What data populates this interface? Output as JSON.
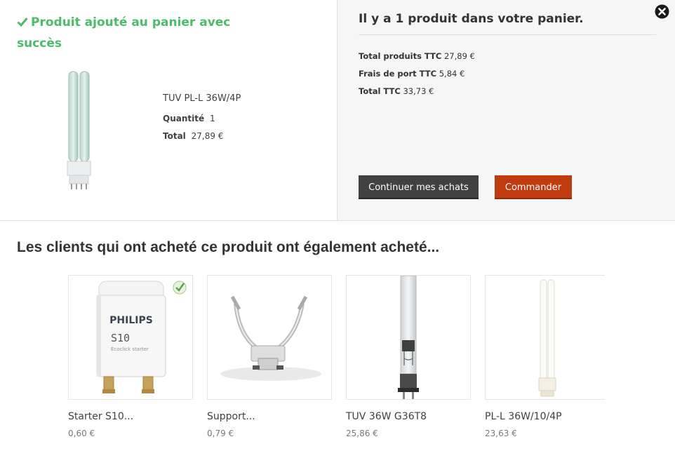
{
  "modal": {
    "success_message": "Produit ajouté au panier avec succès",
    "product": {
      "name": "TUV PL-L 36W/4P",
      "quantity_label": "Quantité",
      "quantity": "1",
      "total_label": "Total",
      "total": "27,89 €"
    },
    "cart": {
      "count_text": "Il y a 1 produit dans votre panier.",
      "totals": [
        {
          "label": "Total produits TTC",
          "value": "27,89 €"
        },
        {
          "label": "Frais de port TTC",
          "value": "5,84 €"
        },
        {
          "label": "Total TTC",
          "value": "33,73 €"
        }
      ]
    },
    "buttons": {
      "continue": "Continuer mes achats",
      "order": "Commander"
    }
  },
  "crossselling": {
    "title": "Les clients qui ont acheté ce produit ont également acheté...",
    "products": [
      {
        "name": "Starter S10...",
        "price": "0,60 €",
        "brand": "PHILIPS",
        "model": "S10",
        "tagline": "Ecoclick starter"
      },
      {
        "name": "Support...",
        "price": "0,79 €"
      },
      {
        "name": "TUV 36W G36T8",
        "price": "25,86 €"
      },
      {
        "name": "PL-L 36W/10/4P",
        "price": "23,63 €"
      }
    ]
  },
  "icons": {
    "success": "check-icon",
    "close": "close-circle-icon",
    "eco_badge": "eco-check-icon"
  },
  "colors": {
    "success_green": "#4cbb6c",
    "order_button": "#c13b10",
    "continue_button": "#414141"
  }
}
